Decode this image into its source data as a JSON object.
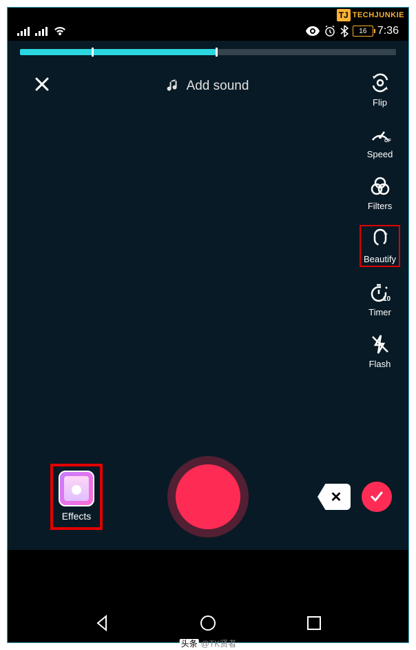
{
  "logo": {
    "badge": "TJ",
    "text": "TECHJUNKIE"
  },
  "status": {
    "battery": "16",
    "time": "7:36"
  },
  "topbar": {
    "add_sound": "Add sound"
  },
  "sidebar": {
    "items": [
      {
        "label": "Flip"
      },
      {
        "label": "Speed"
      },
      {
        "label": "Filters"
      },
      {
        "label": "Beautify"
      },
      {
        "label": "Timer"
      },
      {
        "label": "Flash"
      }
    ]
  },
  "bottom": {
    "effects": "Effects"
  },
  "watermark": {
    "prefix": "头条",
    "handle": "@TK贤者"
  }
}
